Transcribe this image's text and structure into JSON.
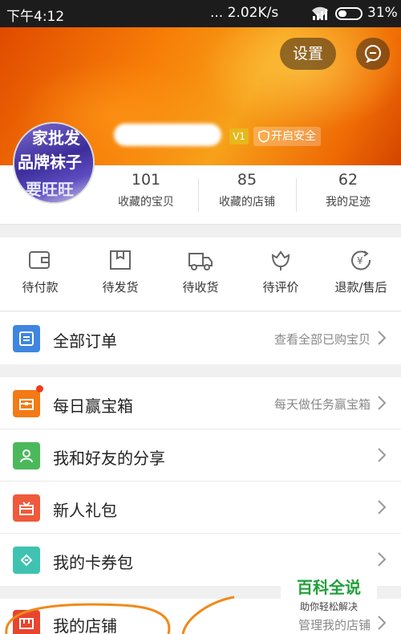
{
  "status_bar": {
    "time": "下午4:12",
    "network_speed": "... 2.02K/s",
    "battery": "31%"
  },
  "header": {
    "settings_label": "设置",
    "security_label": "开启安全",
    "vip_badge": "V1",
    "avatar_text": [
      "家批发",
      "品牌袜子",
      "要旺旺"
    ]
  },
  "stats": [
    {
      "value": "101",
      "label": "收藏的宝贝"
    },
    {
      "value": "85",
      "label": "收藏的店铺"
    },
    {
      "value": "62",
      "label": "我的足迹"
    }
  ],
  "order_tabs": [
    {
      "label": "待付款",
      "icon": "wallet-icon"
    },
    {
      "label": "待发货",
      "icon": "package-icon"
    },
    {
      "label": "待收货",
      "icon": "truck-icon"
    },
    {
      "label": "待评价",
      "icon": "flower-icon"
    },
    {
      "label": "退款/售后",
      "icon": "refund-icon"
    }
  ],
  "all_orders": {
    "title": "全部订单",
    "hint": "查看全部已购宝贝",
    "icon": "list-icon",
    "color": "#3f86e0"
  },
  "menu": [
    {
      "title": "每日赢宝箱",
      "hint": "每天做任务赢宝箱",
      "icon": "treasure-box-icon",
      "color": "#f37a15"
    },
    {
      "title": "我和好友的分享",
      "hint": "",
      "icon": "friends-icon",
      "color": "#4cb85c"
    },
    {
      "title": "新人礼包",
      "hint": "",
      "icon": "gift-icon",
      "color": "#ef5a3c"
    },
    {
      "title": "我的卡券包",
      "hint": "",
      "icon": "coupon-icon",
      "color": "#3fc3b0"
    }
  ],
  "shop": {
    "title": "我的店铺",
    "hint": "管理我的店铺",
    "icon": "shop-icon",
    "color": "#e8452e"
  },
  "watermark": {
    "line1": "百科全说",
    "line2": "助你轻松解决"
  }
}
